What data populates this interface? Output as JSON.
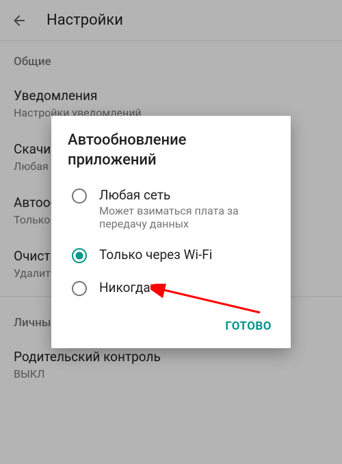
{
  "header": {
    "title": "Настройки"
  },
  "sections": {
    "general": "Общие",
    "personal": "Личные"
  },
  "settings": {
    "notifications": {
      "title": "Уведомления",
      "subtitle": "Настройки уведомлений"
    },
    "downloads": {
      "title": "Скачивание приложений",
      "subtitle": "Любая сеть"
    },
    "autoupdate": {
      "title": "Автообновление приложений",
      "subtitle": "Только через Wi-Fi"
    },
    "clear": {
      "title": "Очистить историю поиска",
      "subtitle": "Удалить все поисковые запросы с этого устройства"
    },
    "parental": {
      "title": "Родительский контроль",
      "subtitle": "ВЫКЛ"
    }
  },
  "dialog": {
    "title": "Автообновление приложений",
    "options": [
      {
        "label": "Любая сеть",
        "sublabel": "Может взиматься плата за передачу данных",
        "selected": false
      },
      {
        "label": "Только через Wi-Fi",
        "sublabel": "",
        "selected": true
      },
      {
        "label": "Никогда",
        "sublabel": "",
        "selected": false
      }
    ],
    "done": "ГОТОВО"
  }
}
